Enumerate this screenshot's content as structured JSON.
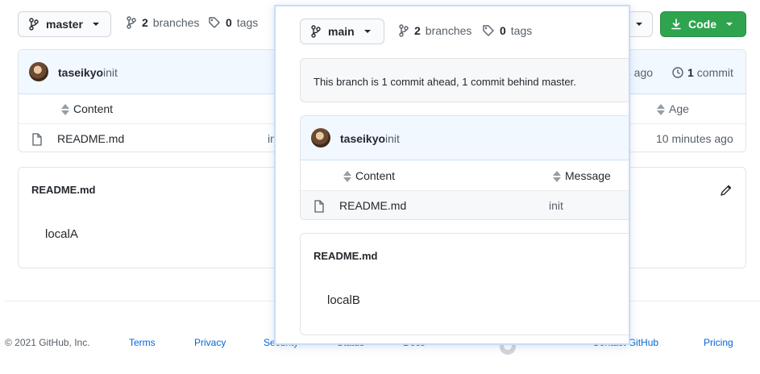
{
  "bg": {
    "branch_label": "master",
    "branches_count": "2",
    "branches_word": "branches",
    "tags_count": "0",
    "tags_word": "tags",
    "code_label": "Code",
    "commit_user": "taseikyo",
    "commit_msg": "init",
    "commit_time": "es ago",
    "commit_count": "1",
    "commit_word": "commit",
    "col_content": "Content",
    "col_age": "Age",
    "file_name": "README.md",
    "file_msg": "in",
    "file_age": "10 minutes ago",
    "readme_title": "README.md",
    "readme_body": "localA"
  },
  "footer": {
    "copyright": "© 2021 GitHub, Inc.",
    "links": [
      "Terms",
      "Privacy",
      "Security",
      "Status",
      "Docs",
      "Contact GitHub",
      "Pricing"
    ]
  },
  "popup": {
    "branch_label": "main",
    "branches_count": "2",
    "branches_word": "branches",
    "tags_count": "0",
    "tags_word": "tags",
    "ahead_behind": "This branch is 1 commit ahead, 1 commit behind master.",
    "commit_user": "taseikyo",
    "commit_msg": "init",
    "col_content": "Content",
    "col_message": "Message",
    "file_name": "README.md",
    "file_msg": "init",
    "readme_title": "README.md",
    "readme_body": "localB"
  },
  "colors": {
    "code_button": "#2ea44f",
    "link": "#0366d6",
    "header_bg": "#f1f8ff"
  }
}
